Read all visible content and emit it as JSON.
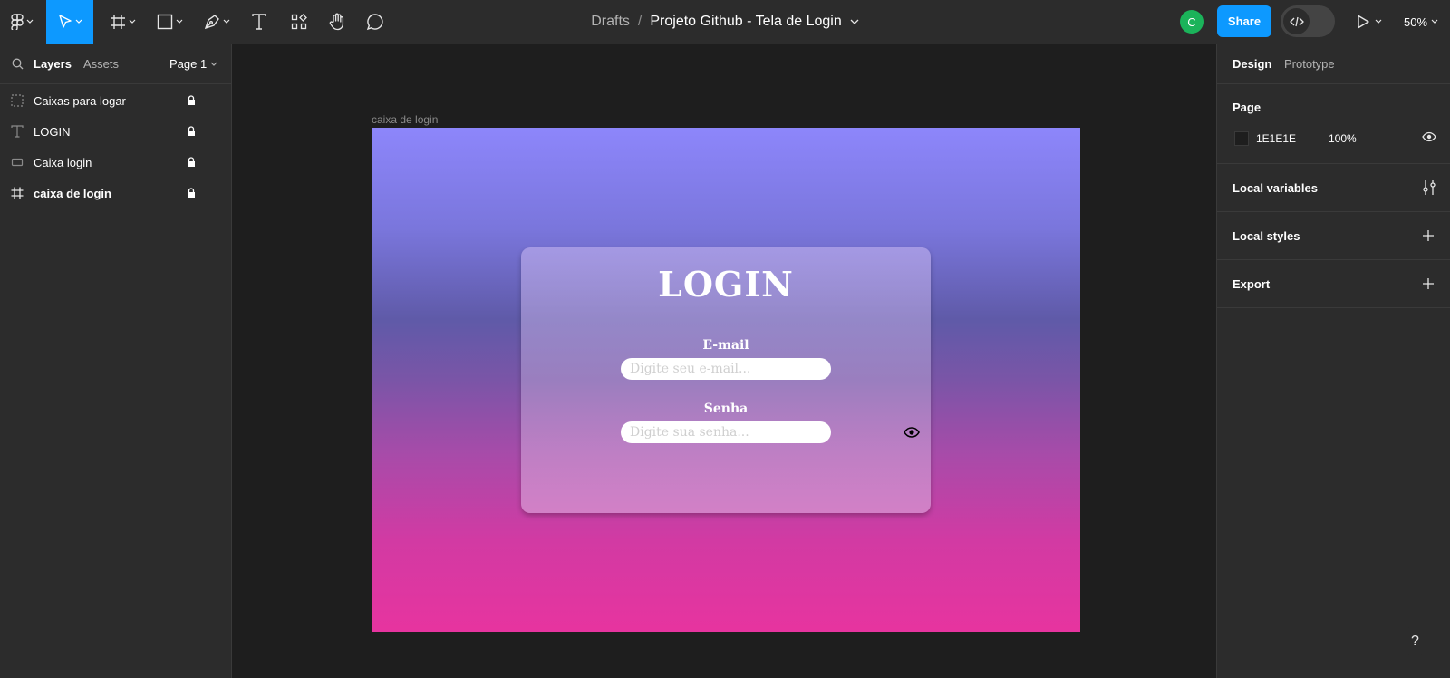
{
  "toolbar": {
    "breadcrumb": {
      "drafts": "Drafts",
      "separator": "/",
      "file_name": "Projeto Github - Tela de Login"
    },
    "avatar_initial": "C",
    "share_label": "Share",
    "zoom_label": "50%",
    "accent_color": "#0d99ff",
    "icons": [
      "figma-menu-icon",
      "move-tool-icon",
      "frame-tool-icon",
      "rectangle-tool-icon",
      "pen-tool-icon",
      "text-tool-icon",
      "resources-icon",
      "hand-tool-icon",
      "comment-icon",
      "dev-mode-icon",
      "present-icon"
    ]
  },
  "left_panel": {
    "tabs": {
      "layers": "Layers",
      "assets": "Assets"
    },
    "page_selector": "Page 1",
    "layers": [
      {
        "name": "Caixas para logar",
        "icon": "group-icon"
      },
      {
        "name": "LOGIN",
        "icon": "text-layer-icon"
      },
      {
        "name": "Caixa login",
        "icon": "rectangle-layer-icon"
      },
      {
        "name": "caixa de login",
        "icon": "frame-layer-icon"
      }
    ]
  },
  "canvas": {
    "frame_label": "caixa de login",
    "login": {
      "title": "LOGIN",
      "email_label": "E-mail",
      "email_placeholder": "Digite seu e-mail...",
      "password_label": "Senha",
      "password_placeholder": "Digite sua senha..."
    }
  },
  "right_panel": {
    "tabs": {
      "design": "Design",
      "prototype": "Prototype"
    },
    "page_section": {
      "title": "Page",
      "color_hex": "1E1E1E",
      "opacity": "100%"
    },
    "sections": [
      "Local variables",
      "Local styles",
      "Export"
    ]
  },
  "help_label": "?"
}
